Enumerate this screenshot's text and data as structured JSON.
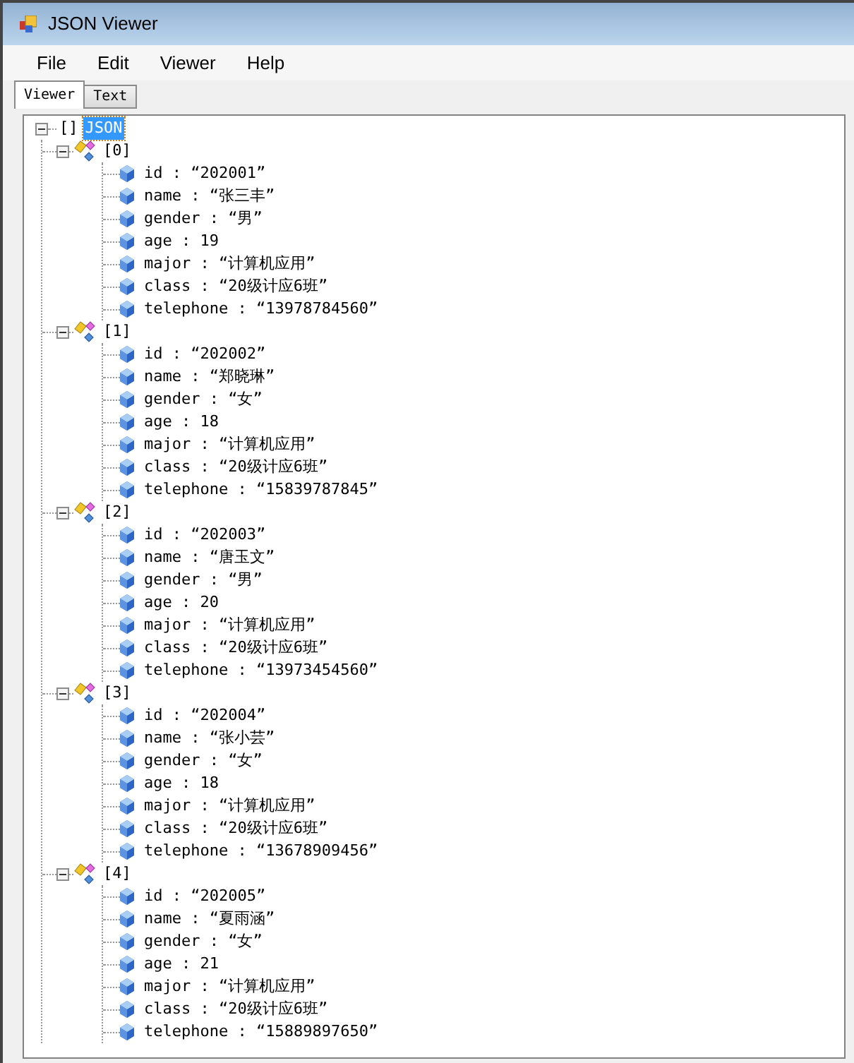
{
  "window": {
    "title": "JSON Viewer"
  },
  "menu": [
    "File",
    "Edit",
    "Viewer",
    "Help"
  ],
  "tabs": [
    {
      "label": "Viewer",
      "selected": true
    },
    {
      "label": "Text",
      "selected": false
    }
  ],
  "tree": {
    "type_mark": "[]",
    "label": "JSON",
    "selected": true,
    "expanded": true,
    "children": [
      {
        "label": "[0]",
        "expanded": true,
        "children": [
          "id : “202001”",
          "name : “张三丰”",
          "gender : “男”",
          "age : 19",
          "major : “计算机应用”",
          "class : “20级计应6班”",
          "telephone : “13978784560”"
        ]
      },
      {
        "label": "[1]",
        "expanded": true,
        "children": [
          "id : “202002”",
          "name : “郑晓琳”",
          "gender : “女”",
          "age : 18",
          "major : “计算机应用”",
          "class : “20级计应6班”",
          "telephone : “15839787845”"
        ]
      },
      {
        "label": "[2]",
        "expanded": true,
        "children": [
          "id : “202003”",
          "name : “唐玉文”",
          "gender : “男”",
          "age : 20",
          "major : “计算机应用”",
          "class : “20级计应6班”",
          "telephone : “13973454560”"
        ]
      },
      {
        "label": "[3]",
        "expanded": true,
        "children": [
          "id : “202004”",
          "name : “张小芸”",
          "gender : “女”",
          "age : 18",
          "major : “计算机应用”",
          "class : “20级计应6班”",
          "telephone : “13678909456”"
        ]
      },
      {
        "label": "[4]",
        "expanded": true,
        "children": [
          "id : “202005”",
          "name : “夏雨涵”",
          "gender : “女”",
          "age : 21",
          "major : “计算机应用”",
          "class : “20级计应6班”",
          "telephone : “15889897650”"
        ]
      }
    ]
  }
}
